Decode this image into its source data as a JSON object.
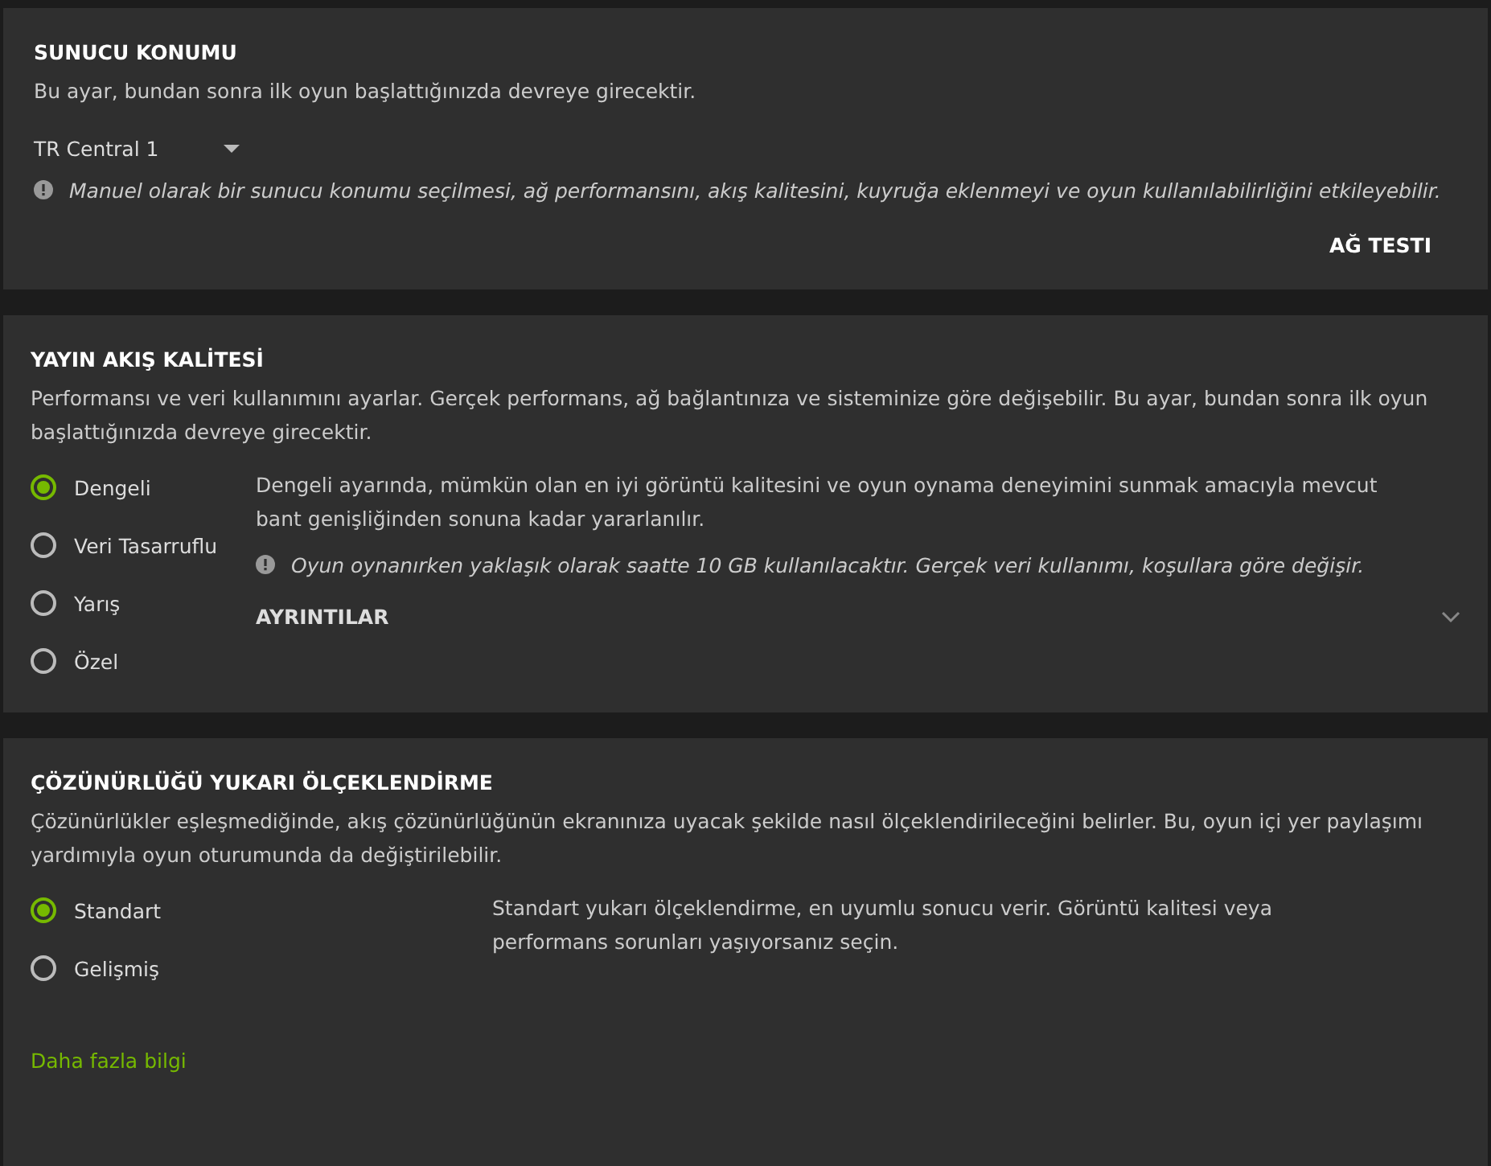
{
  "server_location": {
    "title": "SUNUCU KONUMU",
    "description": "Bu ayar, bundan sonra ilk oyun başlattığınızda devreye girecektir.",
    "dropdown": {
      "value": "TR Central 1"
    },
    "notice": "Manuel olarak bir sunucu konumu seçilmesi, ağ performansını, akış kalitesini, kuyruğa eklenmeyi ve oyun kullanılabilirliğini etkileyebilir.",
    "button": "AĞ TESTI"
  },
  "stream_quality": {
    "title": "YAYIN AKIŞ KALİTESİ",
    "description": "Performansı ve veri kullanımını ayarlar. Gerçek performans, ağ bağlantınıza ve sisteminize göre değişebilir. Bu ayar, bundan sonra ilk oyun başlattığınızda devreye girecektir.",
    "options": [
      {
        "label": "Dengeli",
        "selected": true
      },
      {
        "label": "Veri Tasarruflu",
        "selected": false
      },
      {
        "label": "Yarış",
        "selected": false
      },
      {
        "label": "Özel",
        "selected": false
      }
    ],
    "option_description": "Dengeli ayarında, mümkün olan en iyi görüntü kalitesini ve oyun oynama deneyimini sunmak amacıyla mevcut bant genişliğinden sonuna kadar yararlanılır.",
    "notice": "Oyun oynanırken yaklaşık olarak saatte 10 GB kullanılacaktır. Gerçek veri kullanımı, koşullara göre değişir.",
    "details": {
      "label": "AYRINTILAR",
      "expanded": false
    }
  },
  "upscaling": {
    "title": "ÇÖZÜNÜRLÜĞÜ YUKARI ÖLÇEKLENDİRME",
    "description": "Çözünürlükler eşleşmediğinde, akış çözünürlüğünün ekranınıza uyacak şekilde nasıl ölçeklendirileceğini belirler. Bu, oyun içi yer paylaşımı yardımıyla oyun oturumunda da değiştirilebilir.",
    "options": [
      {
        "label": "Standart",
        "selected": true
      },
      {
        "label": "Gelişmiş",
        "selected": false
      }
    ],
    "option_description": "Standart yukarı ölçeklendirme, en uyumlu sonucu verir. Görüntü kalitesi veya performans sorunları yaşıyorsanız seçin.",
    "link": "Daha fazla bilgi"
  }
}
